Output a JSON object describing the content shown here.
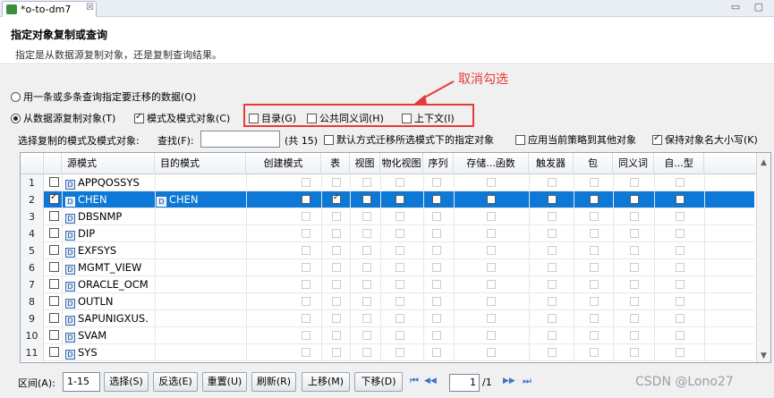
{
  "tab": {
    "title": "*o-to-dm7",
    "close": "☒"
  },
  "window_buttons": "▭ ▢",
  "header": {
    "title": "指定对象复制或查询",
    "description": "指定是从数据源复制对象，还是复制查询结果。"
  },
  "annotation": {
    "text": "取消勾选"
  },
  "options": {
    "radio_query": "用一条或多条查询指定要迁移的数据(Q)",
    "radio_copy": "从数据源复制对象(T)",
    "cb_schema_objects": "模式及模式对象(C)",
    "cb_catalog": "目录(G)",
    "cb_public_synonym": "公共同义词(H)",
    "cb_context": "上下文(I)"
  },
  "filter": {
    "select_label": "选择复制的模式及模式对象:",
    "search_label": "查找(F):",
    "search_value": "",
    "count": "(共 15)",
    "cb_default_migrate": "默认方式迁移所选模式下的指定对象",
    "cb_apply_policy": "应用当前策略到其他对象",
    "cb_keep_case": "保持对象名大小写(K)"
  },
  "grid": {
    "headers": [
      "源模式",
      "目的模式",
      "创建模式",
      "表",
      "视图",
      "物化视图",
      "序列",
      "存储...函数",
      "触发器",
      "包",
      "同义词",
      "自...型"
    ],
    "rows": [
      {
        "num": "1",
        "source": "APPQOSSYS",
        "target": "",
        "checked": false
      },
      {
        "num": "2",
        "source": "CHEN",
        "target": "CHEN",
        "checked": true
      },
      {
        "num": "3",
        "source": "DBSNMP",
        "target": "",
        "checked": false
      },
      {
        "num": "4",
        "source": "DIP",
        "target": "",
        "checked": false
      },
      {
        "num": "5",
        "source": "EXFSYS",
        "target": "",
        "checked": false
      },
      {
        "num": "6",
        "source": "MGMT_VIEW",
        "target": "",
        "checked": false
      },
      {
        "num": "7",
        "source": "ORACLE_OCM",
        "target": "",
        "checked": false
      },
      {
        "num": "8",
        "source": "OUTLN",
        "target": "",
        "checked": false
      },
      {
        "num": "9",
        "source": "SAPUNIGXUS.",
        "target": "",
        "checked": false
      },
      {
        "num": "10",
        "source": "SVAM",
        "target": "",
        "checked": false
      },
      {
        "num": "11",
        "source": "SYS",
        "target": "",
        "checked": false
      }
    ]
  },
  "bottom": {
    "range_label": "区间(A):",
    "range_value": "1-15",
    "btn_select": "选择(S)",
    "btn_invert": "反选(E)",
    "btn_reset": "重置(U)",
    "btn_refresh": "刷新(R)",
    "btn_up": "上移(M)",
    "btn_down": "下移(D)",
    "page_current": "1",
    "page_total": "/1",
    "nav_first": "⏮",
    "nav_prev": "◀◀",
    "nav_next": "▶▶",
    "nav_last": "⏭"
  },
  "watermark": "CSDN @Lono27"
}
